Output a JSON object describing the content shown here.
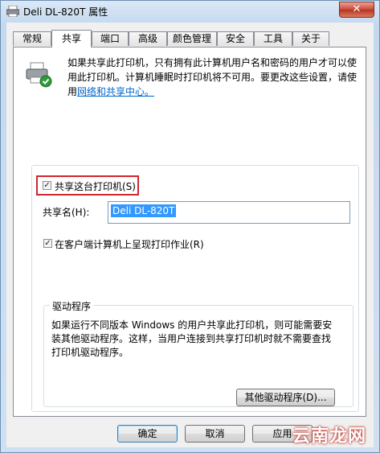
{
  "window": {
    "title": "Deli DL-820T 属性",
    "close_glyph": "✕"
  },
  "tabs": [
    {
      "label": "常规"
    },
    {
      "label": "共享"
    },
    {
      "label": "端口"
    },
    {
      "label": "高级"
    },
    {
      "label": "颜色管理"
    },
    {
      "label": "安全"
    },
    {
      "label": "工具"
    },
    {
      "label": "关于"
    }
  ],
  "active_tab": "共享",
  "info": {
    "text_line1": "如果共享此打印机，只有拥有此计算机用户名和密码的用户才可以使",
    "text_line2": "用此打印机。计算机睡眠时打印机将不可用。要更改这些设置，请使",
    "text_prefix": "用",
    "link": "网络和共享中心。"
  },
  "share_checkbox": {
    "label": "共享这台打印机(S)",
    "checked": true
  },
  "share_name": {
    "label": "共享名(H):",
    "value": "Deli DL-820T"
  },
  "render_checkbox": {
    "label": "在客户端计算机上呈现打印作业(R)",
    "checked": true
  },
  "drivers": {
    "title": "驱动程序",
    "line1": "如果运行不同版本 Windows 的用户共享此打印机，则可能需要安",
    "line2": "装其他驱动程序。这样，当用户连接到共享打印机时就不需要查找",
    "line3": "打印机驱动程序。",
    "button": "其他驱动程序(D)..."
  },
  "buttons": {
    "ok": "确定",
    "cancel": "取消",
    "apply": "应用"
  },
  "watermark": "云南龙网",
  "colors": {
    "highlight": "#d0272f",
    "link": "#0066cc",
    "selection": "#3399ff"
  }
}
